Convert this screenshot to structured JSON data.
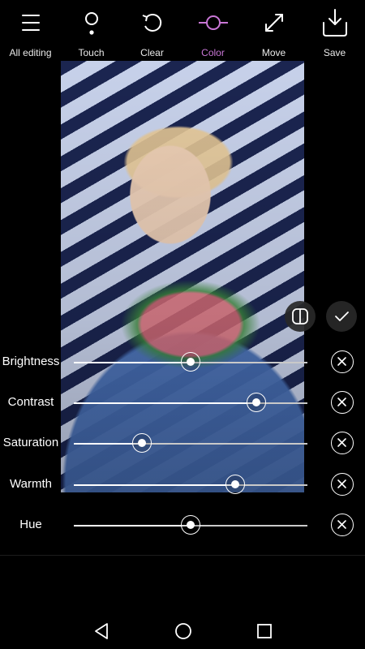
{
  "toolbar": {
    "items": [
      {
        "label": "All editing",
        "icon": "menu-icon",
        "active": false
      },
      {
        "label": "Touch",
        "icon": "touch-icon",
        "active": false
      },
      {
        "label": "Clear",
        "icon": "undo-icon",
        "active": false
      },
      {
        "label": "Color",
        "icon": "color-icon",
        "active": true
      },
      {
        "label": "Move",
        "icon": "expand-icon",
        "active": false
      },
      {
        "label": "Save",
        "icon": "save-icon",
        "active": false
      }
    ],
    "active_color": "#c977d6"
  },
  "photo": {
    "subject": "woman-with-flowers"
  },
  "actions": {
    "compare_icon": "compare-icon",
    "confirm_icon": "check-icon"
  },
  "adjustments": [
    {
      "label": "Brightness",
      "value": 0.5
    },
    {
      "label": "Contrast",
      "value": 0.78
    },
    {
      "label": "Saturation",
      "value": 0.29
    },
    {
      "label": "Warmth",
      "value": 0.69
    },
    {
      "label": "Hue",
      "value": 0.5
    }
  ],
  "navbar": {
    "back_icon": "back-triangle-icon",
    "home_icon": "home-circle-icon",
    "recent_icon": "recents-square-icon"
  }
}
